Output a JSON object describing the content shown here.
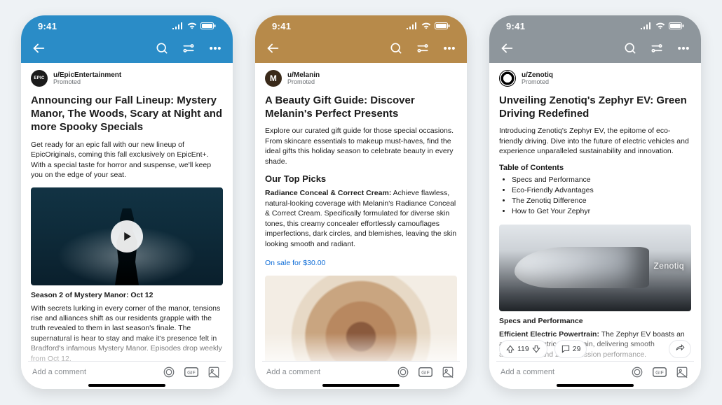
{
  "ui": {
    "status_time": "9:41",
    "comment_placeholder": "Add a comment",
    "promoted_label": "Promoted"
  },
  "phones": [
    {
      "header_color": "blue",
      "poster": {
        "name": "u/EpicEntertainment",
        "avatar_text": "EPIC",
        "avatar_variant": "solid"
      },
      "title": "Announcing our Fall Lineup: Mystery Manor, The Woods, Scary at Night and more Spooky Specials",
      "intro": "Get ready for an epic fall with our new lineup of EpicOriginals, coming this fall exclusively on EpicEnt+. With a special taste for horror and suspense, we'll keep you on the edge of your seat.",
      "media_caption": "Season 2 of Mystery Manor: Oct 12",
      "body2": "With secrets lurking in every corner of the manor, tensions rise and alliances shift as our residents grapple with the truth revealed to them in last season's finale. The supernatural is hear to stay and make it's presence felt in Bradford's infamous Mystery Manor. Episodes drop weekly from Oct 12."
    },
    {
      "header_color": "tan",
      "poster": {
        "name": "u/Melanin",
        "avatar_text": "M",
        "avatar_variant": "circle"
      },
      "title": "A Beauty Gift Guide: Discover Melanin's Perfect Presents",
      "intro": "Explore our curated gift guide for those special occasions. From skincare essentials to makeup must-haves, find the ideal gifts this holiday season to celebrate beauty in every shade.",
      "subhead": "Our Top Picks",
      "pick_name": "Radiance Conceal & Correct Cream:",
      "pick_desc": " Achieve flawless, natural-looking coverage with Melanin's Radiance Conceal & Correct Cream. Specifically formulated for diverse skin tones, this creamy concealer effortlessly camouflages imperfections, dark circles, and blemishes, leaving the skin looking smooth and radiant.",
      "price_link": "On sale for $30.00"
    },
    {
      "header_color": "slate",
      "poster": {
        "name": "u/Zenotiq",
        "avatar_text": "",
        "avatar_variant": "ring"
      },
      "title": "Unveiling Zenotiq's Zephyr EV: Green Driving Redefined",
      "intro": "Introducing Zenotiq's Zephyr EV, the epitome of eco-friendly driving. Dive into the future of electric vehicles and experience unparalleled sustainability and innovation.",
      "toc_title": "Table of Contents",
      "toc": [
        "Specs and Performance",
        "Eco-Friendly Advantages",
        "The Zenotiq Difference",
        "How to Get Your Zephyr"
      ],
      "image_brand": "Zenotiq",
      "section_heading": "Specs and Performance",
      "feature_name": "Efficient Electric Powertrain:",
      "feature_desc": " The Zephyr EV boasts an advanced electric powertrain, delivering smooth acceleration and zero-emission performance.",
      "votes": "119",
      "comments": "29"
    }
  ]
}
